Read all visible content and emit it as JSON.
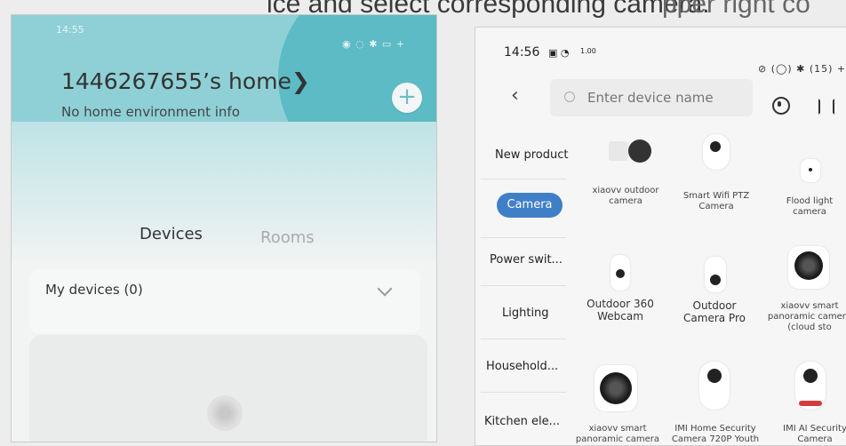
{
  "caption": {
    "text_main": "ice and select corresponding camera.",
    "text_right": "pper right co"
  },
  "left_phone": {
    "status_time": "14:55",
    "home_title": "1446267655’s home❯",
    "home_subtitle": "No home environment info",
    "add_label": "+",
    "tabs": [
      "Devices",
      "Rooms"
    ],
    "my_devices_label": "My devices (0)"
  },
  "right_phone": {
    "status_time": "14:56",
    "status_net": "1.00",
    "status_right": "⊘ (◯) ✱ (15) +",
    "back_label": "‹",
    "search_placeholder": "Enter device name",
    "categories": [
      "New product",
      "Camera",
      "Power swit...",
      "Lighting",
      "Household...",
      "Kitchen ele..."
    ],
    "active_category": "Camera",
    "products": [
      "xiaovv outdoor camera",
      "Smart Wifi PTZ Camera",
      "Flood light camera",
      "Outdoor 360 Webcam",
      "Outdoor Camera Pro",
      "xiaovv smart panoramic camera (cloud sto",
      "xiaovv smart panoramic camera",
      "IMI Home Security Camera 720P Youth",
      "IMI AI Security Camera"
    ]
  },
  "colors": {
    "accent_blue": "#3f7fc7",
    "teal": "#54b7c2"
  }
}
